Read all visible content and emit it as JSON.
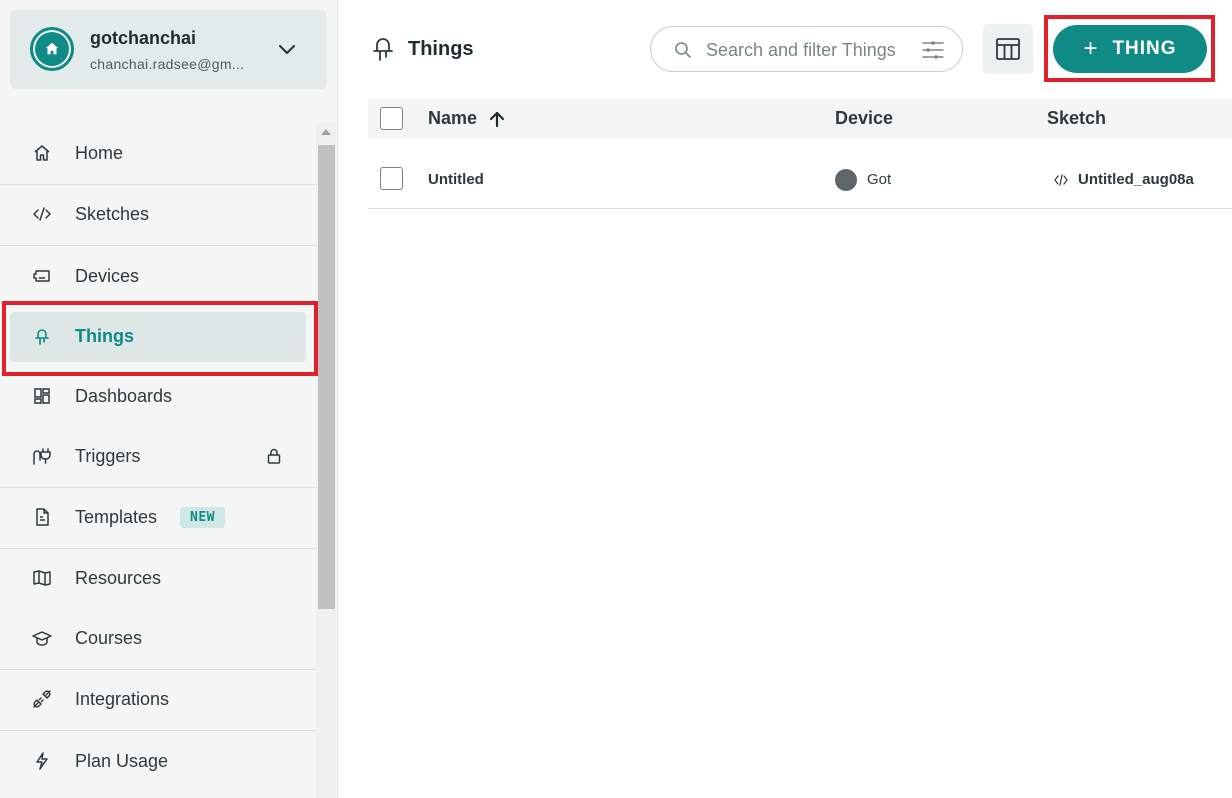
{
  "account": {
    "name": "gotchanchai",
    "email": "chanchai.radsee@gm..."
  },
  "sidebar": {
    "items": [
      {
        "label": "Home",
        "icon": "home-icon"
      },
      {
        "label": "Sketches",
        "icon": "code-icon"
      },
      {
        "label": "Devices",
        "icon": "device-icon"
      },
      {
        "label": "Things",
        "icon": "bulb-icon",
        "active": true
      },
      {
        "label": "Dashboards",
        "icon": "dashboard-icon"
      },
      {
        "label": "Triggers",
        "icon": "plug-icon",
        "locked": true
      },
      {
        "label": "Templates",
        "icon": "template-icon",
        "badge": "NEW"
      },
      {
        "label": "Resources",
        "icon": "book-icon"
      },
      {
        "label": "Courses",
        "icon": "graduation-cap-icon"
      },
      {
        "label": "Integrations",
        "icon": "connector-icon"
      },
      {
        "label": "Plan Usage",
        "icon": "lightning-icon"
      }
    ]
  },
  "header": {
    "title": "Things",
    "search_placeholder": "Search and filter Things",
    "add_button_label": "THING"
  },
  "table": {
    "columns": [
      "Name",
      "Device",
      "Sketch"
    ],
    "rows": [
      {
        "name": "Untitled",
        "device": "Got",
        "sketch": "Untitled_aug08a"
      }
    ]
  },
  "colors": {
    "accent": "#0f8a85",
    "highlight": "#e0202a",
    "sidebar_bg": "#f4f6f6",
    "device_status": "#5f666a"
  }
}
